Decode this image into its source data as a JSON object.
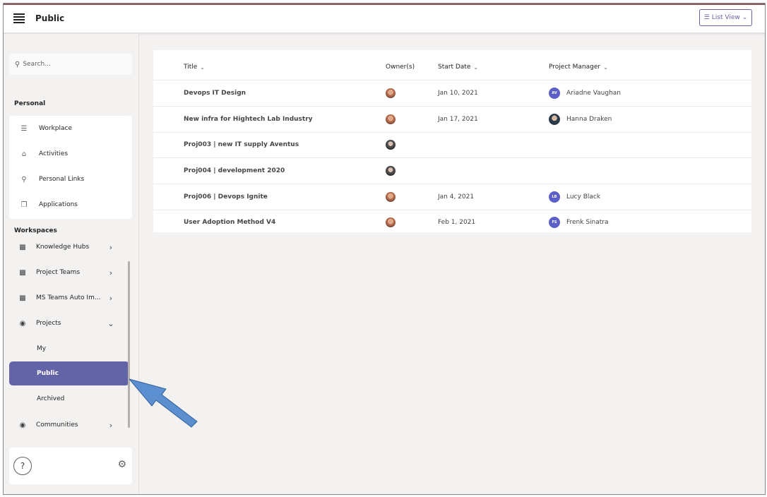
{
  "header": {
    "title": "Public",
    "view_button_label": "List View"
  },
  "sidebar": {
    "search_placeholder": "Search...",
    "personal_label": "Personal",
    "personal_items": [
      {
        "label": "Workplace",
        "icon": "list-icon"
      },
      {
        "label": "Activities",
        "icon": "home-icon"
      },
      {
        "label": "Personal Links",
        "icon": "person-icon"
      },
      {
        "label": "Applications",
        "icon": "copy-icon"
      }
    ],
    "workspaces_label": "Workspaces",
    "workspace_items": [
      {
        "label": "Knowledge Hubs",
        "icon": "teams-icon",
        "expanded": false
      },
      {
        "label": "Project Teams",
        "icon": "teams-icon",
        "expanded": false
      },
      {
        "label": "MS Teams Auto Im...",
        "icon": "teams-icon",
        "expanded": false
      },
      {
        "label": "Projects",
        "icon": "sharepoint-icon",
        "expanded": true
      },
      {
        "label": "Communities",
        "icon": "sharepoint-icon",
        "expanded": false
      }
    ],
    "project_subitems": [
      {
        "label": "My",
        "active": false
      },
      {
        "label": "Public",
        "active": true
      },
      {
        "label": "Archived",
        "active": false
      }
    ],
    "help_label": "?"
  },
  "table": {
    "columns": {
      "title": "Title",
      "owners": "Owner(s)",
      "start_date": "Start Date",
      "project_manager": "Project Manager"
    },
    "rows": [
      {
        "title": "Devops IT Design",
        "owner_avatar": "p1",
        "start_date": "Jan 10, 2021",
        "pm_initials": "AV",
        "pm_name": "Ariadne Vaughan",
        "pm_photo": false
      },
      {
        "title": "New infra for Hightech Lab Industry",
        "owner_avatar": "p1",
        "start_date": "Jan 17, 2021",
        "pm_initials": "",
        "pm_name": "Hanna Draken",
        "pm_photo": true
      },
      {
        "title": "Proj003 | new IT supply Aventus",
        "owner_avatar": "p2",
        "start_date": "",
        "pm_initials": "",
        "pm_name": "",
        "pm_photo": false
      },
      {
        "title": "Proj004 | development 2020",
        "owner_avatar": "p2",
        "start_date": "",
        "pm_initials": "",
        "pm_name": "",
        "pm_photo": false
      },
      {
        "title": "Proj006 | Devops Ignite",
        "owner_avatar": "p1",
        "start_date": "Jan 4, 2021",
        "pm_initials": "LB",
        "pm_name": "Lucy Black",
        "pm_photo": false
      },
      {
        "title": "User Adoption Method V4",
        "owner_avatar": "p1",
        "start_date": "Feb 1, 2021",
        "pm_initials": "FS",
        "pm_name": "Frenk Sinatra",
        "pm_photo": false
      }
    ]
  },
  "colors": {
    "accent": "#6264a7",
    "annotation_arrow": "#5b8fd0"
  }
}
